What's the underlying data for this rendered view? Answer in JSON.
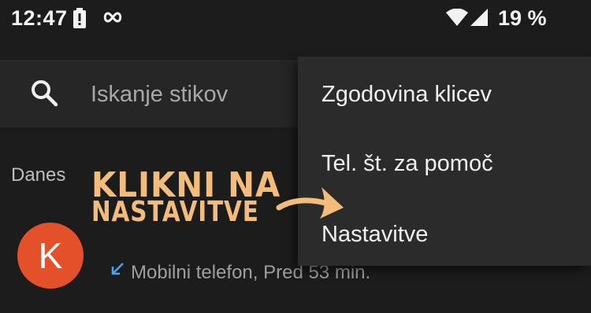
{
  "status_bar": {
    "time": "12:47",
    "battery_percent": "19 %",
    "icons": [
      "battery-alert-icon",
      "infinity-icon",
      "wifi-icon",
      "signal-icon"
    ]
  },
  "search": {
    "placeholder": "Iskanje stikov"
  },
  "list": {
    "section_label": "Danes",
    "contact": {
      "avatar_letter": "K",
      "avatar_color": "#e4502a",
      "call_detail": "Mobilni telefon, Pred 53 min."
    }
  },
  "menu": {
    "items": [
      {
        "label": "Zgodovina klicev"
      },
      {
        "label": "Tel. št. za pomoč"
      },
      {
        "label": "Nastavitve"
      }
    ]
  },
  "annotation": {
    "line1": "KLIKNI NA",
    "line2": "NASTAVITVE",
    "color": "#f4bc7a"
  }
}
